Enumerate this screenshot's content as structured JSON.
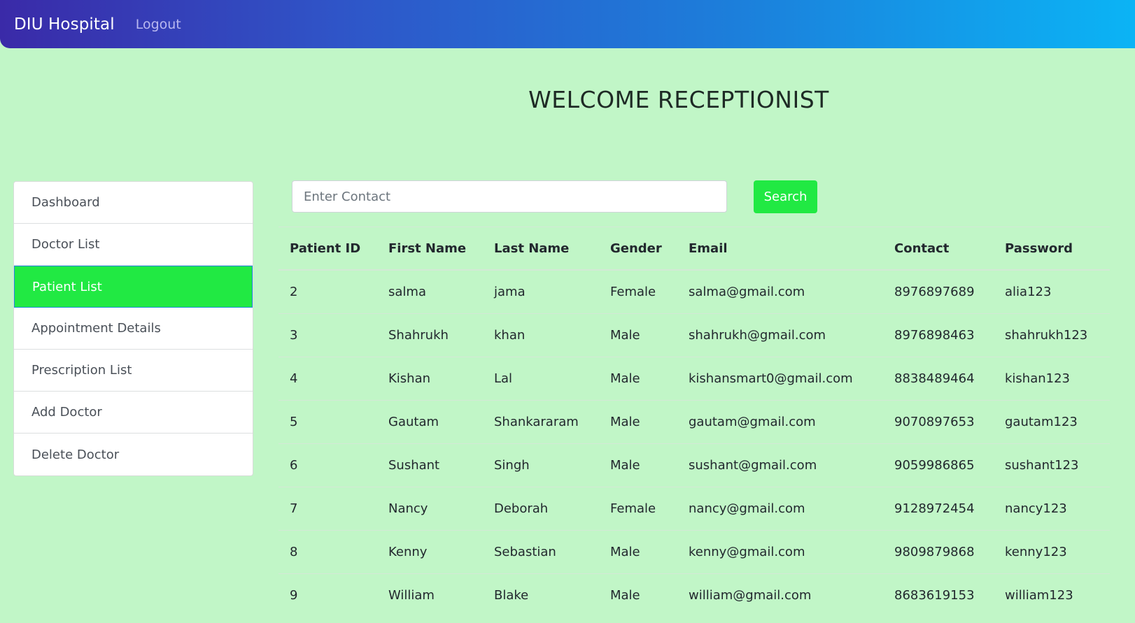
{
  "navbar": {
    "brand": "DIU Hospital",
    "logout_label": "Logout",
    "gradient_colors": [
      "#3a2aa8",
      "#0bb4f5"
    ]
  },
  "page": {
    "welcome_title": "WELCOME RECEPTIONIST"
  },
  "sidebar": {
    "items": [
      {
        "label": "Dashboard",
        "active": false
      },
      {
        "label": "Doctor List",
        "active": false
      },
      {
        "label": "Patient List",
        "active": true
      },
      {
        "label": "Appointment Details",
        "active": false
      },
      {
        "label": "Prescription List",
        "active": false
      },
      {
        "label": "Add Doctor",
        "active": false
      },
      {
        "label": "Delete Doctor",
        "active": false
      }
    ]
  },
  "search": {
    "placeholder": "Enter Contact",
    "value": "",
    "button_label": "Search"
  },
  "table": {
    "headers": [
      "Patient ID",
      "First Name",
      "Last Name",
      "Gender",
      "Email",
      "Contact",
      "Password"
    ],
    "rows": [
      [
        "2",
        "salma",
        "jama",
        "Female",
        "salma@gmail.com",
        "8976897689",
        "alia123"
      ],
      [
        "3",
        "Shahrukh",
        "khan",
        "Male",
        "shahrukh@gmail.com",
        "8976898463",
        "shahrukh123"
      ],
      [
        "4",
        "Kishan",
        "Lal",
        "Male",
        "kishansmart0@gmail.com",
        "8838489464",
        "kishan123"
      ],
      [
        "5",
        "Gautam",
        "Shankararam",
        "Male",
        "gautam@gmail.com",
        "9070897653",
        "gautam123"
      ],
      [
        "6",
        "Sushant",
        "Singh",
        "Male",
        "sushant@gmail.com",
        "9059986865",
        "sushant123"
      ],
      [
        "7",
        "Nancy",
        "Deborah",
        "Female",
        "nancy@gmail.com",
        "9128972454",
        "nancy123"
      ],
      [
        "8",
        "Kenny",
        "Sebastian",
        "Male",
        "kenny@gmail.com",
        "9809879868",
        "kenny123"
      ],
      [
        "9",
        "William",
        "Blake",
        "Male",
        "william@gmail.com",
        "8683619153",
        "william123"
      ]
    ]
  },
  "colors": {
    "page_background": "#c1f6c7",
    "accent_green": "#21e943",
    "active_border": "#1a8fd8"
  }
}
